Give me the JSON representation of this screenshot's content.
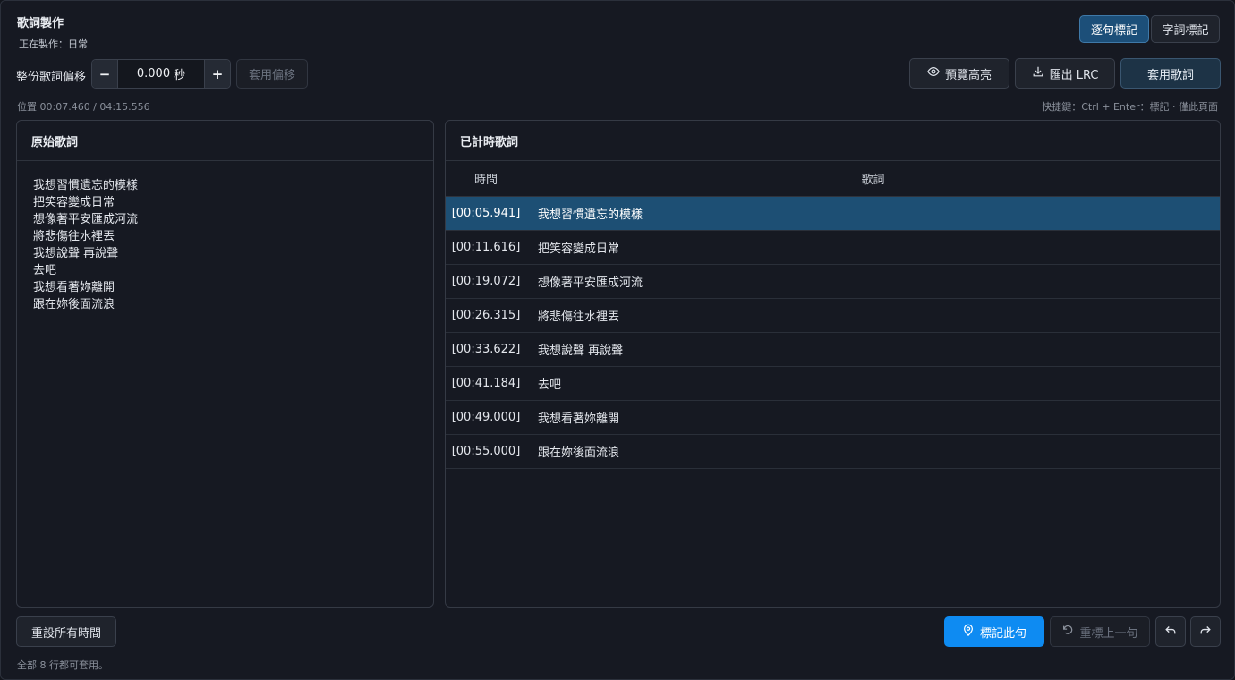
{
  "app": {
    "title": "歌詞製作",
    "subtitle": "正在製作：日常"
  },
  "mode_toggle": {
    "line_mode": "逐句標記",
    "word_mode": "字詞標記"
  },
  "offset": {
    "label": "整份歌詞偏移",
    "minus": "−",
    "plus": "+",
    "value": "0.000",
    "unit": "秒",
    "apply": "套用偏移"
  },
  "toolbar": {
    "preview": "預覽高亮",
    "export": "匯出 LRC",
    "apply_lyrics": "套用歌詞"
  },
  "status": {
    "position": "位置 00:07.460 / 04:15.556",
    "shortcut_hint": "快捷鍵：Ctrl + Enter：標記 · 僅此頁面"
  },
  "raw_panel": {
    "title": "原始歌詞",
    "lines": [
      "我想習慣遺忘的模樣",
      "把笑容變成日常",
      "想像著平安匯成河流",
      "將悲傷往水裡丟",
      "我想說聲 再說聲",
      "去吧",
      "我想看著妳離開",
      "跟在妳後面流浪"
    ]
  },
  "timed_panel": {
    "title": "已計時歌詞",
    "col_time": "時間",
    "col_lyric": "歌詞",
    "rows": [
      {
        "time": "[00:05.941]",
        "lyric": "我想習慣遺忘的模樣"
      },
      {
        "time": "[00:11.616]",
        "lyric": "把笑容變成日常"
      },
      {
        "time": "[00:19.072]",
        "lyric": "想像著平安匯成河流"
      },
      {
        "time": "[00:26.315]",
        "lyric": "將悲傷往水裡丟"
      },
      {
        "time": "[00:33.622]",
        "lyric": "我想說聲 再說聲"
      },
      {
        "time": "[00:41.184]",
        "lyric": "去吧"
      },
      {
        "time": "[00:49.000]",
        "lyric": "我想看著妳離開"
      },
      {
        "time": "[00:55.000]",
        "lyric": "跟在妳後面流浪"
      }
    ]
  },
  "bottom": {
    "reset": "重設所有時間",
    "mark": "標記此句",
    "remark_prev": "重標上一句",
    "note": "全部 8 行都可套用。"
  },
  "colors": {
    "accent": "#0e8bf2",
    "selected_row": "#1d4f74",
    "background": "#161922"
  }
}
